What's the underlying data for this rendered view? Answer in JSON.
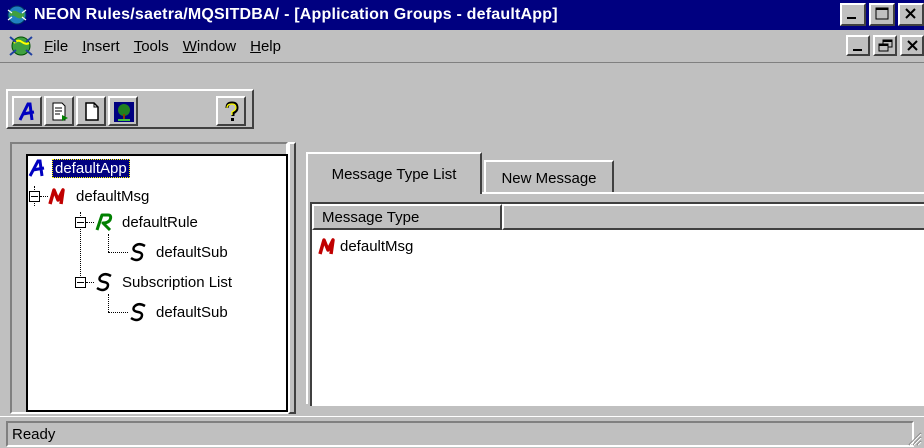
{
  "window": {
    "title": "NEON Rules/saetra/MQSITDBA/ - [Application Groups - defaultApp]",
    "icon": "neon-globe-icon"
  },
  "menu": {
    "items": [
      {
        "label": "File",
        "mnemonic": "F"
      },
      {
        "label": "Insert",
        "mnemonic": "I"
      },
      {
        "label": "Tools",
        "mnemonic": "T"
      },
      {
        "label": "Window",
        "mnemonic": "W"
      },
      {
        "label": "Help",
        "mnemonic": "H"
      }
    ]
  },
  "toolbar": {
    "buttons": [
      {
        "name": "application-icon"
      },
      {
        "name": "document-arrow-icon"
      },
      {
        "name": "new-document-icon"
      },
      {
        "name": "tree-icon"
      },
      {
        "name": "help-question-icon"
      }
    ]
  },
  "tree": {
    "nodes": [
      {
        "label": "defaultApp",
        "type": "application",
        "icon": "application-A-icon",
        "selected": true
      },
      {
        "label": "defaultMsg",
        "type": "message",
        "icon": "message-M-icon"
      },
      {
        "label": "defaultRule",
        "type": "rule",
        "icon": "rule-R-icon"
      },
      {
        "label": "defaultSub",
        "type": "subscription",
        "icon": "subscription-S-icon"
      },
      {
        "label": "Subscription List",
        "type": "subscription-list",
        "icon": "subscription-S-icon"
      },
      {
        "label": "defaultSub",
        "type": "subscription",
        "icon": "subscription-S-icon"
      }
    ]
  },
  "tabs": [
    {
      "label": "Message Type List",
      "active": true
    },
    {
      "label": "New Message",
      "active": false
    }
  ],
  "list": {
    "columns": [
      "Message Type",
      ""
    ],
    "rows": [
      {
        "icon": "message-M-icon",
        "label": "defaultMsg"
      }
    ]
  },
  "status": {
    "text": "Ready"
  },
  "colors": {
    "titlebar": "#000080",
    "face": "#c0c0c0",
    "app_icon_blue": "#0000c0",
    "message_icon_red": "#c00000",
    "rule_icon_green": "#008000"
  }
}
